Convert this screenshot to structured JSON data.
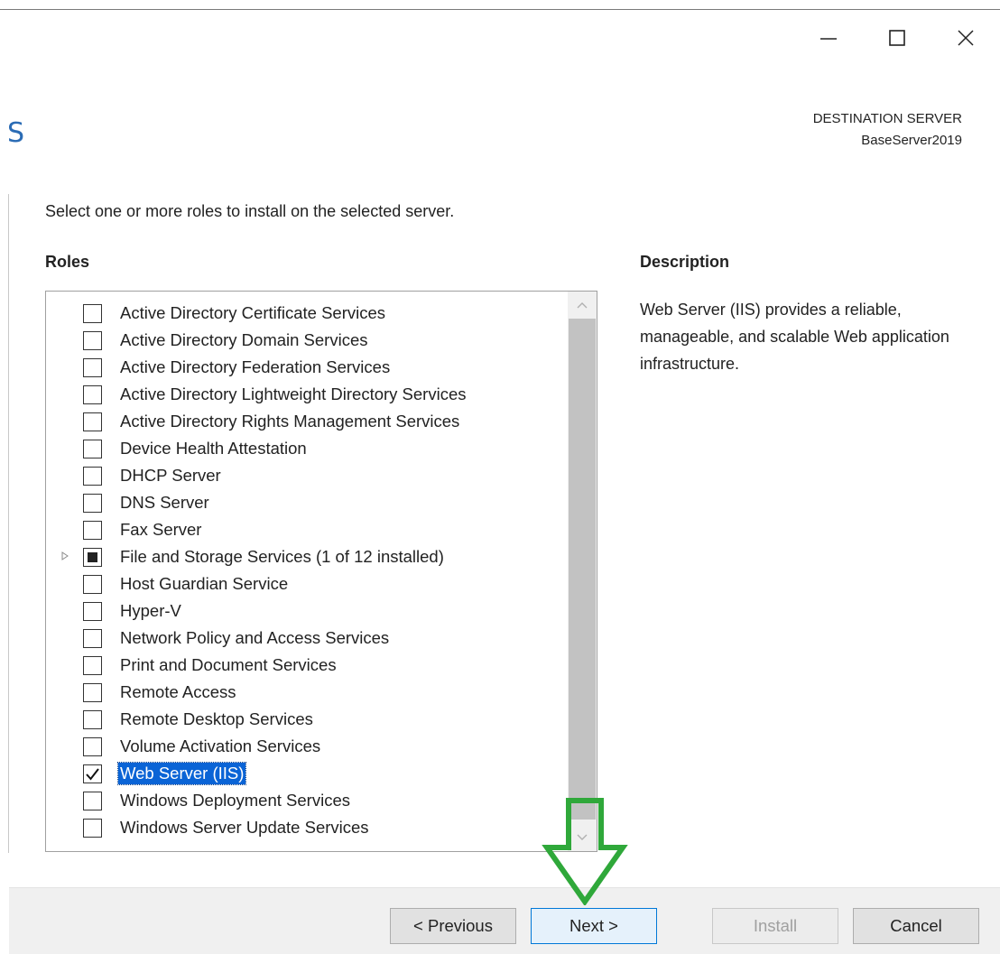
{
  "window": {
    "title_fragment": "S",
    "destination_server_label": "DESTINATION SERVER",
    "destination_server_name": "BaseServer2019",
    "controls": [
      "minimize-icon",
      "maximize-icon",
      "close-icon"
    ]
  },
  "main": {
    "instruction": "Select one or more roles to install on the selected server.",
    "roles_heading": "Roles",
    "description_heading": "Description",
    "description_text": "Web Server (IIS) provides a reliable, manageable, and scalable Web application infrastructure.",
    "roles": [
      {
        "label": "Active Directory Certificate Services",
        "state": "unchecked"
      },
      {
        "label": "Active Directory Domain Services",
        "state": "unchecked"
      },
      {
        "label": "Active Directory Federation Services",
        "state": "unchecked"
      },
      {
        "label": "Active Directory Lightweight Directory Services",
        "state": "unchecked"
      },
      {
        "label": "Active Directory Rights Management Services",
        "state": "unchecked"
      },
      {
        "label": "Device Health Attestation",
        "state": "unchecked"
      },
      {
        "label": "DHCP Server",
        "state": "unchecked"
      },
      {
        "label": "DNS Server",
        "state": "unchecked"
      },
      {
        "label": "Fax Server",
        "state": "unchecked"
      },
      {
        "label": "File and Storage Services (1 of 12 installed)",
        "state": "partial",
        "expandable": true
      },
      {
        "label": "Host Guardian Service",
        "state": "unchecked"
      },
      {
        "label": "Hyper-V",
        "state": "unchecked"
      },
      {
        "label": "Network Policy and Access Services",
        "state": "unchecked"
      },
      {
        "label": "Print and Document Services",
        "state": "unchecked"
      },
      {
        "label": "Remote Access",
        "state": "unchecked"
      },
      {
        "label": "Remote Desktop Services",
        "state": "unchecked"
      },
      {
        "label": "Volume Activation Services",
        "state": "unchecked"
      },
      {
        "label": "Web Server (IIS)",
        "state": "checked",
        "selected": true
      },
      {
        "label": "Windows Deployment Services",
        "state": "unchecked"
      },
      {
        "label": "Windows Server Update Services",
        "state": "unchecked"
      }
    ]
  },
  "footer": {
    "previous_label": "< Previous",
    "next_label": "Next >",
    "install_label": "Install",
    "cancel_label": "Cancel"
  },
  "colors": {
    "accent": "#0078d7",
    "selection": "#0a64d6",
    "annotation_arrow": "#2fa83a"
  }
}
